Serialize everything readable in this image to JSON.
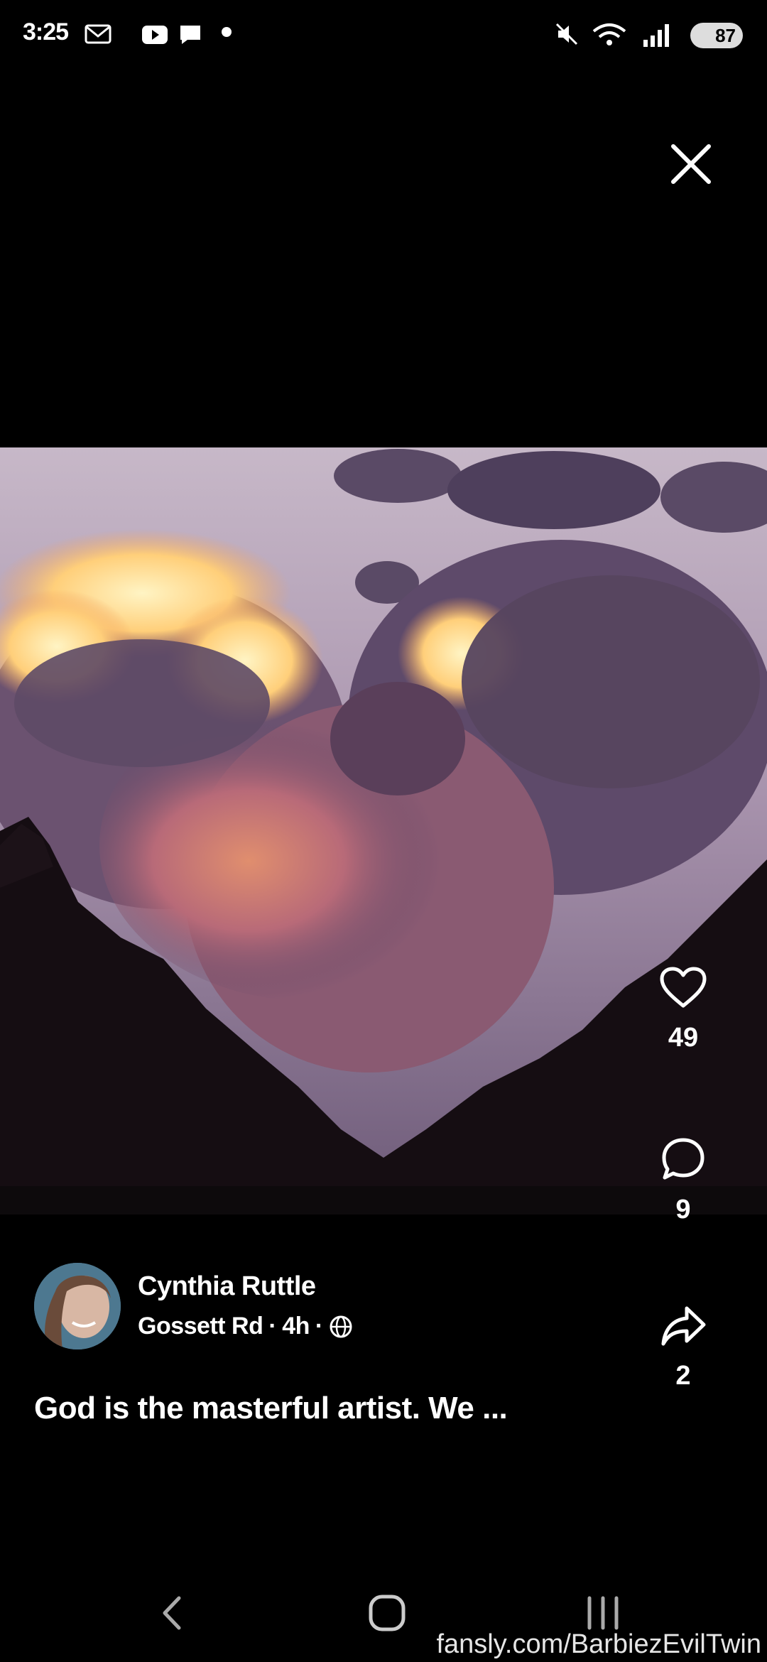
{
  "status_bar": {
    "time": "3:25",
    "battery": "87",
    "left_icons": [
      "gmail-icon",
      "youtube-icon",
      "chat-icon"
    ],
    "right_icons": [
      "mute-icon",
      "wifi-icon",
      "signal-icon"
    ]
  },
  "post": {
    "author_name": "Cynthia Ruttle",
    "location": "Gossett Rd",
    "time_ago": "4h",
    "separator": "·",
    "caption": "God is the masterful artist.  We ..."
  },
  "actions": {
    "likes": "49",
    "comments": "9",
    "shares": "2"
  },
  "watermark": "fansly.com/BarbiezEvilTwin",
  "colors": {
    "background": "#000000",
    "text": "#ffffff"
  }
}
